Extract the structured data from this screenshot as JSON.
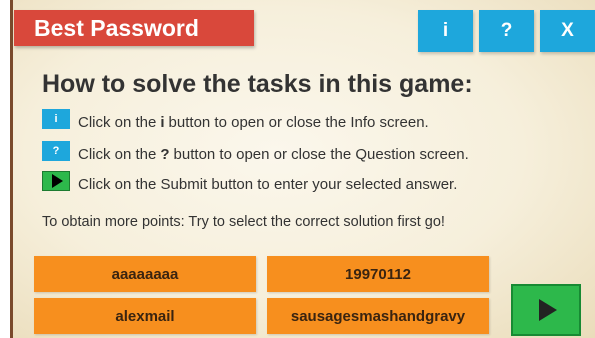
{
  "game": {
    "title": "Best Password"
  },
  "toolbar": {
    "info_label": "i",
    "question_label": "?",
    "close_label": "X"
  },
  "instructions": {
    "heading": "How to solve the tasks in this game:",
    "lines": [
      {
        "icon": "info-icon",
        "icon_label": "i",
        "before": "Click on the",
        "key": "i",
        "after": "button to open or close the Info screen."
      },
      {
        "icon": "question-icon",
        "icon_label": "?",
        "before": "Click on the",
        "key": "?",
        "after": "button to open or close the Question screen."
      },
      {
        "icon": "submit-play-icon",
        "before": "Click on the Submit button to enter your selected answer."
      }
    ],
    "tip": "To obtain more points: Try to select the correct solution first go!"
  },
  "answers": [
    {
      "label": "aaaaaaaa"
    },
    {
      "label": "19970112"
    },
    {
      "label": "alexmail"
    },
    {
      "label": "sausagesmashandgravy"
    }
  ],
  "colors": {
    "title_bar": "#d9483b",
    "top_buttons": "#1ea7dc",
    "answer_buttons": "#f78f1e",
    "submit_button": "#2db84b",
    "panel_background": "#f6efdb"
  }
}
